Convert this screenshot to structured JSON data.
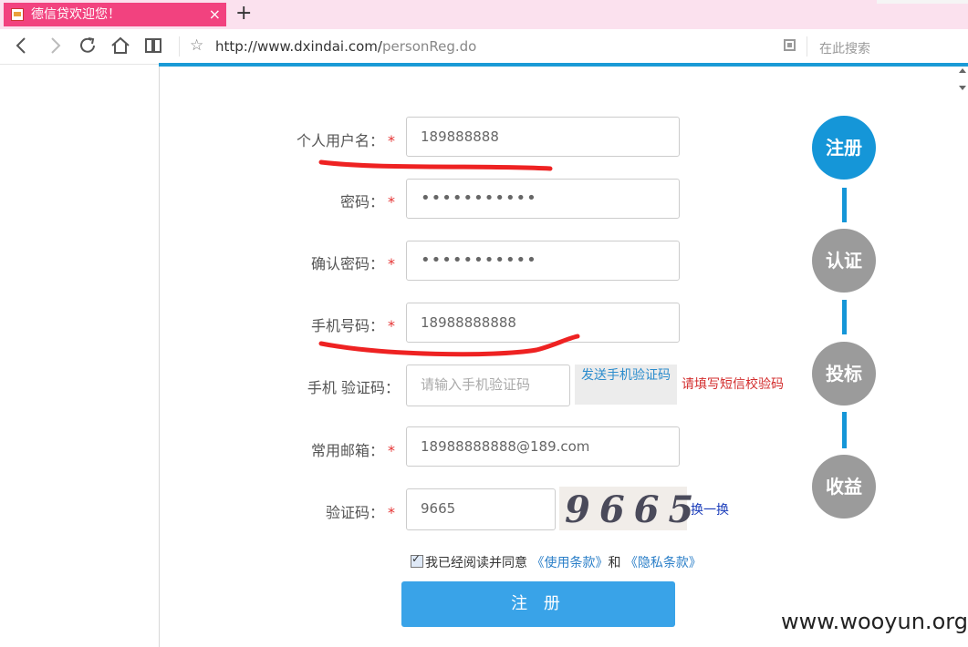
{
  "browser": {
    "tab_title": "德信贷欢迎您！",
    "tab_close": "×",
    "new_tab": "+",
    "url_host": "http://www.dxindai.com/",
    "url_path": "personReg.do",
    "search_placeholder": "在此搜索"
  },
  "form": {
    "username": {
      "label": "个人用户名：",
      "value": "189888888"
    },
    "password": {
      "label": "密码：",
      "value": "•••••••••••"
    },
    "confirm_password": {
      "label": "确认密码：",
      "value": "•••••••••••"
    },
    "phone": {
      "label": "手机号码：",
      "value": "18988888888"
    },
    "sms_code": {
      "label": "手机 验证码：",
      "placeholder": "请输入手机验证码",
      "send_button": "发送手机验证码",
      "hint": "请填写短信校验码"
    },
    "email": {
      "label": "常用邮箱：",
      "value": "18988888888@189.com"
    },
    "captcha": {
      "label": "验证码：",
      "value": "9665",
      "image_text": "9665",
      "refresh": "换一换"
    },
    "required_mark": "*",
    "agreement": {
      "prefix": "我已经阅读并同意",
      "terms": "《使用条款》",
      "and": "和",
      "privacy": "《隐私条款》",
      "checked": true
    },
    "submit": "注 册"
  },
  "steps": [
    {
      "label": "注册",
      "active": true
    },
    {
      "label": "认证",
      "active": false
    },
    {
      "label": "投标",
      "active": false
    },
    {
      "label": "收益",
      "active": false
    }
  ],
  "watermark": "www.wooyun.org",
  "colors": {
    "accent": "#1596d8",
    "tab": "#f2427f",
    "required": "#e53333",
    "annotation": "#ee2222"
  }
}
